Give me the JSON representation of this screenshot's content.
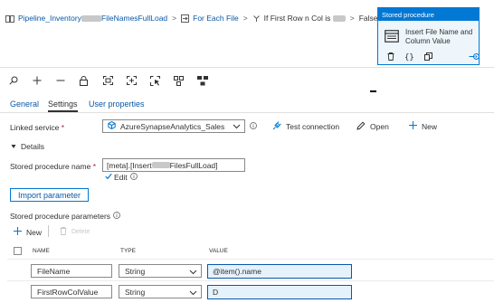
{
  "breadcrumb": {
    "pipeline": "Pipeline_Inventory",
    "pipeline_suffix": "FileNamesFullLoad",
    "for_each": "For Each File",
    "if_condition_prefix": "If First Row n Col is",
    "false_activities": "False activities"
  },
  "activity_card": {
    "header": "Stored procedure",
    "name_line1": "Insert File Name and",
    "name_line2": "Column Value",
    "icons": [
      "delete-icon",
      "code-icon",
      "copy-icon",
      "add-output-icon"
    ]
  },
  "toolbar": {
    "icons": [
      "search-icon",
      "zoom-in-icon",
      "zoom-out-icon",
      "lock-icon",
      "fit-to-screen-icon",
      "fit-center-icon",
      "select-icon",
      "auto-align-icon",
      "layout-icon"
    ]
  },
  "tabs": [
    {
      "label": "General"
    },
    {
      "label": "Settings"
    },
    {
      "label": "User properties"
    }
  ],
  "settings": {
    "linked_service_label": "Linked service",
    "required_marker": "*",
    "linked_service_value": "AzureSynapseAnalytics_Sales",
    "test_connection": "Test connection",
    "open": "Open",
    "new": "New",
    "details_label": "Details",
    "sp_name_label": "Stored procedure name",
    "sp_name_prefix": "[meta].[Insert",
    "sp_name_suffix": "FilesFullLoad]",
    "edit_label": "Edit",
    "edit_checked": true,
    "import_button": "Import parameter",
    "params_label": "Stored procedure parameters"
  },
  "params": {
    "new_label": "New",
    "delete_label": "Delete",
    "columns": [
      "NAME",
      "TYPE",
      "VALUE"
    ],
    "rows": [
      {
        "name": "FileName",
        "type": "String",
        "value": "@item().name"
      },
      {
        "name": "FirstRowColValue",
        "type": "String",
        "value": "D"
      }
    ]
  },
  "colors": {
    "accent": "#0078d4",
    "link": "#0a58a5",
    "required": "#a4262c",
    "card_background": "#eef6fc",
    "value_background": "#e6f2fb"
  }
}
